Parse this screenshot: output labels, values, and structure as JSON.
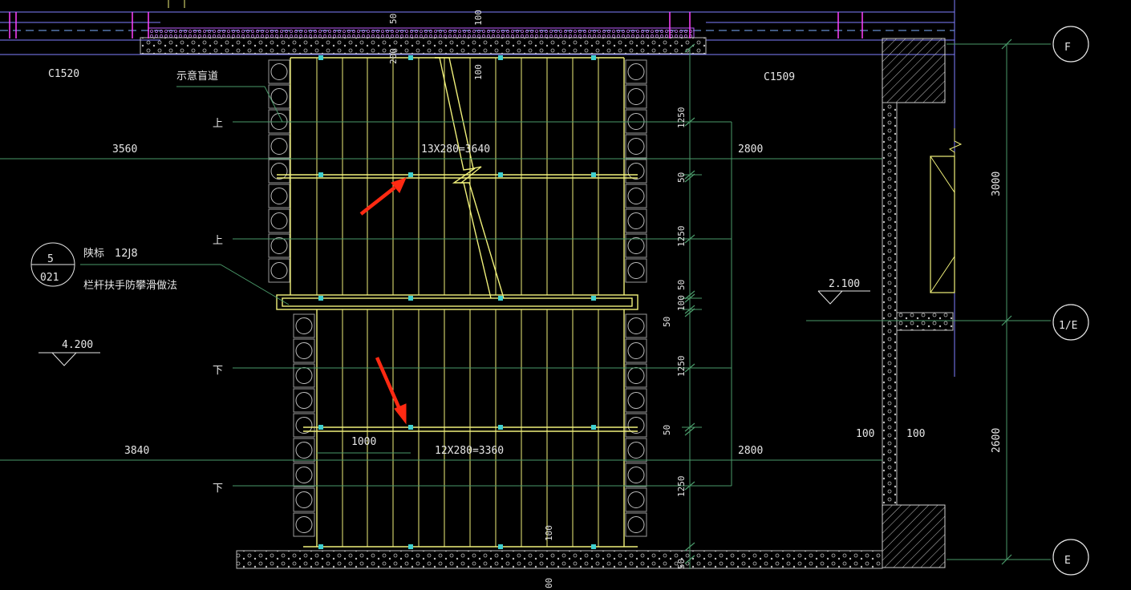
{
  "windows": {
    "left": "C1520",
    "right": "C1509"
  },
  "blind_path_label": "示意盲道",
  "directions": {
    "up1": "上",
    "up2": "上",
    "down1": "下",
    "down2": "下"
  },
  "upper_flight": {
    "label": "13X280=3640",
    "left_dim": "3560",
    "right_dim": "2800"
  },
  "lower_flight": {
    "label": "12X280=3360",
    "left_dim": "3840",
    "right_dim": "2800",
    "inner_dim": "1000"
  },
  "reference": {
    "circle_top": "5",
    "circle_bottom": "021",
    "line1": "陕标　12J8",
    "line2": "栏杆扶手防攀滑做法"
  },
  "elevations": {
    "left": "4.200",
    "right": "2.100"
  },
  "grid_axes": {
    "top": "F",
    "middle": "1/E",
    "bottom": "E"
  },
  "right_dims": {
    "upper": "3000",
    "lower": "2600"
  },
  "bottom_dims": {
    "left": "100",
    "right": "100"
  },
  "vertical_dims": {
    "top_a": "50",
    "top_b": "100",
    "top_c": "200",
    "top_d": "100",
    "r1": "1250",
    "r2": "50",
    "r3": "1250",
    "r4": "50",
    "r5": "100",
    "r6": "50",
    "r7": "1250",
    "r8": "50",
    "r9": "1250",
    "bot1": "100",
    "bot2": "50",
    "bot3": "00"
  },
  "colors": {
    "background": "#000000",
    "stair_lines": "#f0f07a",
    "dimension_lines": "#4a9a6a",
    "wall_blue": "#8080ff",
    "annotation_arrow": "#ff2a12",
    "tactile_tiles": "#9a9a9a",
    "magenta": "#ff40ff"
  },
  "icons": [
    "annotation-arrow-icon",
    "elevation-marker-icon",
    "grid-bubble-icon",
    "section-break-icon"
  ]
}
